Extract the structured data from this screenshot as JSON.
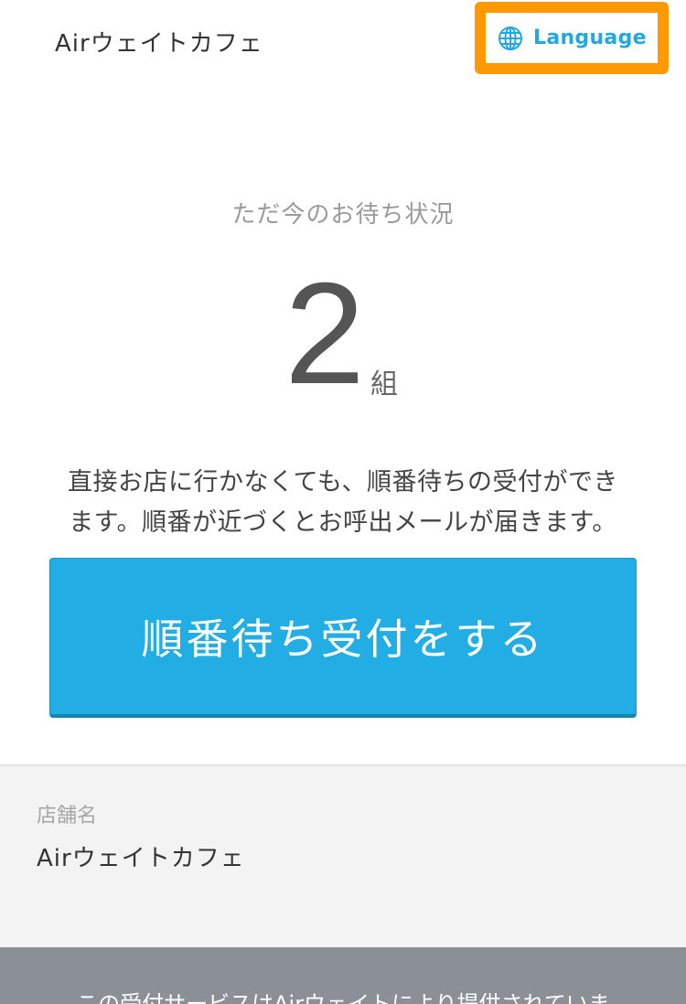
{
  "header": {
    "brand": "Airウェイトカフェ",
    "language_label": "Language",
    "accent_color": "#21a8e3",
    "highlight_color": "#ff9900"
  },
  "status": {
    "title": "ただ今のお待ち状況",
    "count": "2",
    "unit": "組"
  },
  "description": {
    "line1": "直接お店に行かなくても、順番待ちの受付ができ",
    "line2": "ます。順番が近づくとお呼出メールが届きます。"
  },
  "cta": {
    "label": "順番待ち受付をする",
    "color": "#22ade4"
  },
  "store": {
    "label": "店舗名",
    "name": "Airウェイトカフェ"
  },
  "footer": {
    "text": "この受付サービスはAirウェイトにより提供されていま"
  },
  "icons": {
    "language": "globe-icon"
  }
}
